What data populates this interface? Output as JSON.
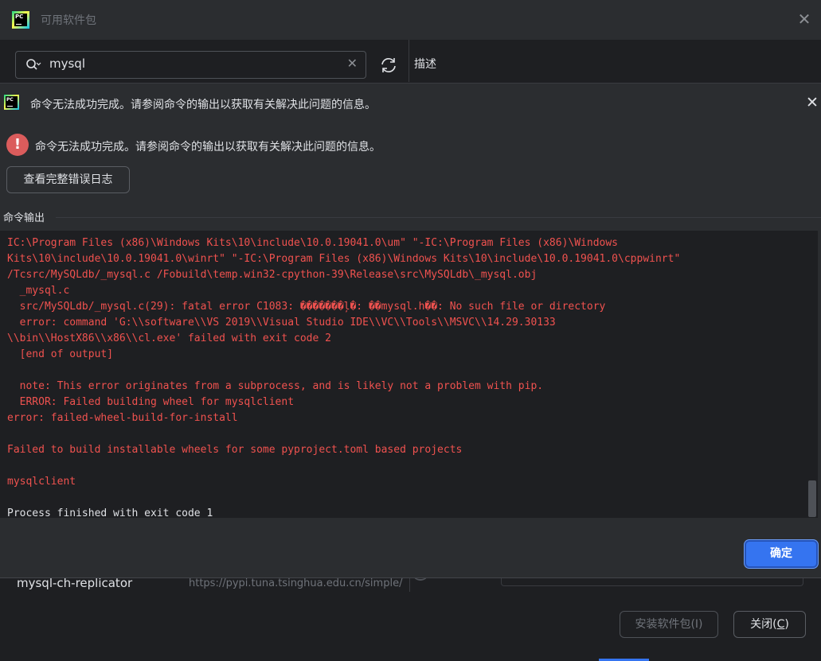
{
  "outer_dialog": {
    "title": "可用软件包",
    "search": {
      "value": "mysql"
    },
    "description_label": "描述",
    "package_row": {
      "name": "mysql-ch-replicator",
      "url": "https://pypi.tuna.tsinghua.edu.cn/simple/"
    },
    "install_button": "安装软件包(I)",
    "close_button_prefix": "关闭(",
    "close_button_mnemonic": "C",
    "close_button_suffix": ")"
  },
  "error_modal": {
    "title": "命令无法成功完成。请参阅命令的输出以获取有关解决此问题的信息。",
    "message": "命令无法成功完成。请参阅命令的输出以获取有关解决此问题的信息。",
    "error_icon_glyph": "!",
    "view_log_button": "查看完整错误日志",
    "output_section_label": "命令输出",
    "output_lines": [
      {
        "text": "IC:\\Program Files (x86)\\Windows Kits\\10\\include\\10.0.19041.0\\um\" \"-IC:\\Program Files (x86)\\Windows",
        "kind": "err"
      },
      {
        "text": "Kits\\10\\include\\10.0.19041.0\\winrt\" \"-IC:\\Program Files (x86)\\Windows Kits\\10\\include\\10.0.19041.0\\cppwinrt\"",
        "kind": "err"
      },
      {
        "text": "/Tcsrc/MySQLdb/_mysql.c /Fobuild\\temp.win32-cpython-39\\Release\\src\\MySQLdb\\_mysql.obj",
        "kind": "err"
      },
      {
        "text": "  _mysql.c",
        "kind": "err"
      },
      {
        "text": "  src/MySQLdb/_mysql.c(29): fatal error C1083: �޷��򿪰����ļ�: ��mysql.h��: No such file or directory",
        "kind": "err"
      },
      {
        "text": "  error: command 'G:\\\\software\\\\VS 2019\\\\Visual Studio IDE\\\\VC\\\\Tools\\\\MSVC\\\\14.29.30133",
        "kind": "err"
      },
      {
        "text": "\\\\bin\\\\HostX86\\\\x86\\\\cl.exe' failed with exit code 2",
        "kind": "err"
      },
      {
        "text": "  [end of output]",
        "kind": "err"
      },
      {
        "text": "",
        "kind": "err"
      },
      {
        "text": "  note: This error originates from a subprocess, and is likely not a problem with pip.",
        "kind": "err"
      },
      {
        "text": "  ERROR: Failed building wheel for mysqlclient",
        "kind": "err"
      },
      {
        "text": "error: failed-wheel-build-for-install",
        "kind": "err"
      },
      {
        "text": "",
        "kind": "err"
      },
      {
        "text": "Failed to build installable wheels for some pyproject.toml based projects",
        "kind": "err"
      },
      {
        "text": "",
        "kind": "err"
      },
      {
        "text": "mysqlclient",
        "kind": "err"
      },
      {
        "text": "",
        "kind": "err"
      },
      {
        "text": "Process finished with exit code 1",
        "kind": "ok"
      }
    ],
    "ok_button": "确定"
  },
  "colors": {
    "error_text": "#f0524f",
    "accent": "#3574f0",
    "error_icon_bg": "#db5c5c"
  }
}
